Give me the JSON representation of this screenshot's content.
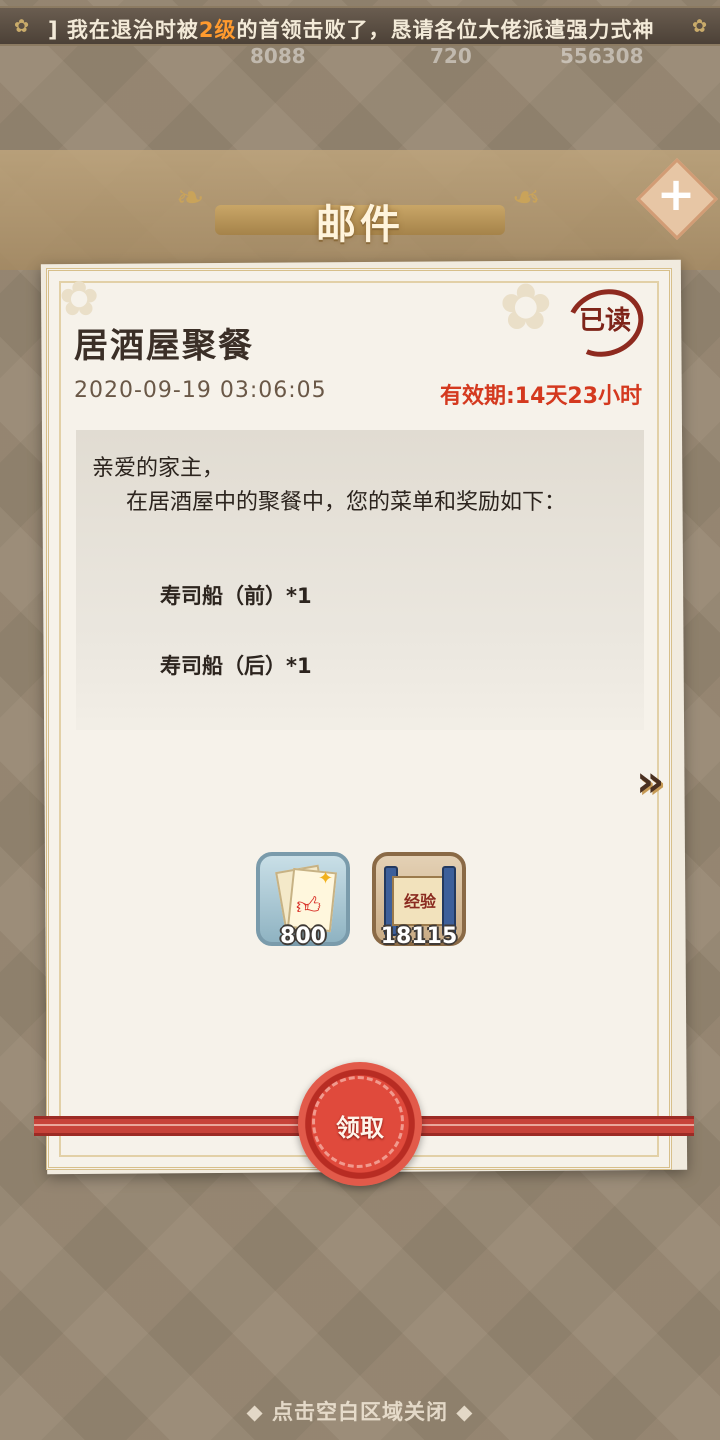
{
  "marquee": {
    "prefix": "] 我在退治时被",
    "highlight": "2级",
    "suffix": "的首领击败了，恳请各位大佬派遣强力式神",
    "highlight_color": "#ff9a2e"
  },
  "background": {
    "numbers": [
      "8088",
      "720",
      "556308"
    ]
  },
  "header": {
    "title": "邮件"
  },
  "mail": {
    "title": "居酒屋聚餐",
    "status_stamp": "已读",
    "date": "2020-09-19 03:06:05",
    "validity": "有效期:14天23小时",
    "validity_color": "#d4391f",
    "greeting": "亲爱的家主，",
    "intro": "在居酒屋中的聚餐中，您的菜单和奖励如下：",
    "items": [
      "寿司船（前）*1",
      "寿司船（后）*1"
    ]
  },
  "rewards": [
    {
      "icon": "thumbs-up-card-icon",
      "count": "800"
    },
    {
      "icon": "experience-scroll-icon",
      "label": "经验",
      "count": "18115"
    }
  ],
  "actions": {
    "claim_label": "领取",
    "next_icon": "chevron-right-icon"
  },
  "footer": {
    "close_hint": "◆ 点击空白区域关闭 ◆"
  }
}
